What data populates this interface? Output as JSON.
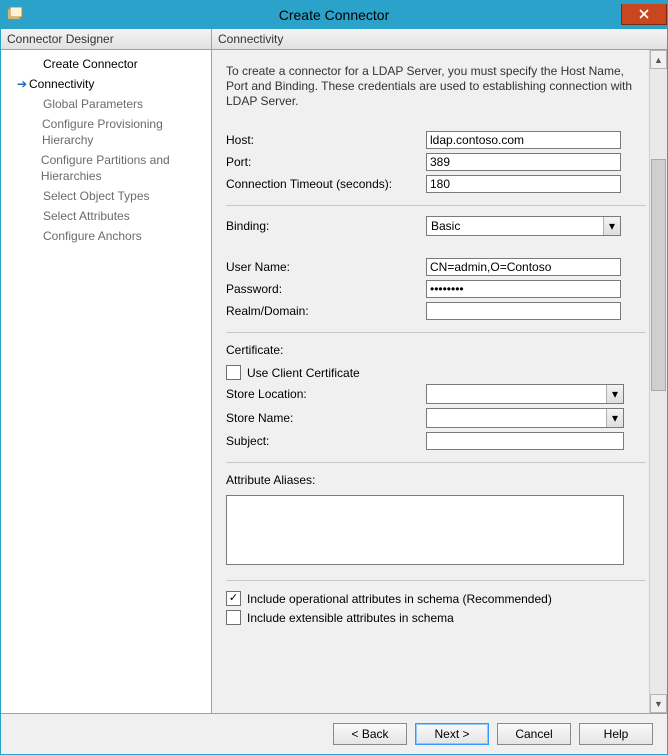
{
  "window": {
    "title": "Create Connector"
  },
  "sidebar": {
    "header": "Connector Designer",
    "items": [
      {
        "label": "Create Connector",
        "state": "done"
      },
      {
        "label": "Connectivity",
        "state": "current"
      },
      {
        "label": "Global Parameters",
        "state": "pending"
      },
      {
        "label": "Configure Provisioning Hierarchy",
        "state": "pending"
      },
      {
        "label": "Configure Partitions and Hierarchies",
        "state": "pending"
      },
      {
        "label": "Select Object Types",
        "state": "pending"
      },
      {
        "label": "Select Attributes",
        "state": "pending"
      },
      {
        "label": "Configure Anchors",
        "state": "pending"
      }
    ]
  },
  "main": {
    "header": "Connectivity",
    "intro": "To create a connector for a LDAP Server, you must specify the Host Name, Port and Binding. These credentials are used to establishing connection with LDAP Server.",
    "labels": {
      "host": "Host:",
      "port": "Port:",
      "timeout": "Connection Timeout (seconds):",
      "binding": "Binding:",
      "username": "User Name:",
      "password": "Password:",
      "realm": "Realm/Domain:",
      "certificate": "Certificate:",
      "useClientCert": "Use Client Certificate",
      "storeLocation": "Store Location:",
      "storeName": "Store Name:",
      "subject": "Subject:",
      "attrAliases": "Attribute Aliases:",
      "includeOperational": "Include operational attributes in schema (Recommended)",
      "includeExtensible": "Include extensible attributes in schema"
    },
    "values": {
      "host": "ldap.contoso.com",
      "port": "389",
      "timeout": "180",
      "binding": "Basic",
      "username": "CN=admin,O=Contoso",
      "password": "••••••••",
      "realm": "",
      "storeLocation": "",
      "storeName": "",
      "subject": "",
      "attrAliases": ""
    },
    "checks": {
      "useClientCert": false,
      "includeOperational": true,
      "includeExtensible": false
    }
  },
  "footer": {
    "back": "<  Back",
    "next": "Next  >",
    "cancel": "Cancel",
    "help": "Help"
  }
}
